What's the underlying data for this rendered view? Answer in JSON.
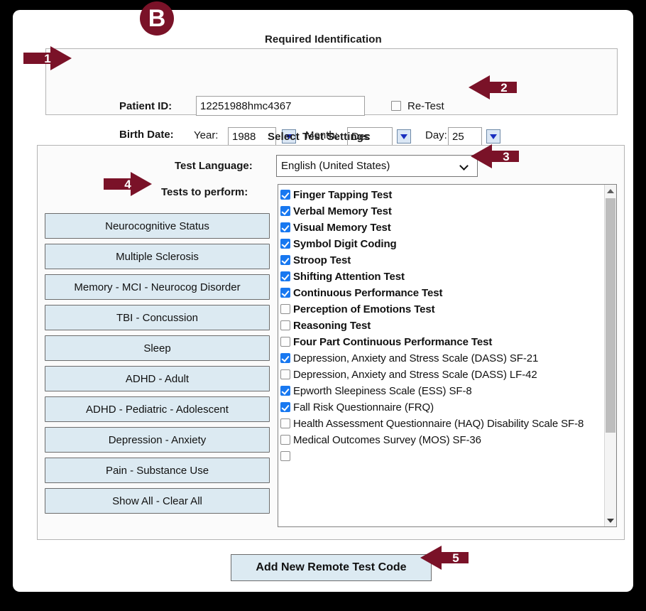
{
  "badge": {
    "letter": "B"
  },
  "identification": {
    "legend": "Required Identification",
    "patient_id_label": "Patient ID:",
    "patient_id_value": "12251988hmc4367",
    "patient_id_placeholder": "",
    "retest_label": "Re-Test",
    "retest_checked": false,
    "birth_date_label": "Birth Date:",
    "year_label": "Year:",
    "year_value": "1988",
    "month_label": "Month:",
    "month_value": "Dec",
    "day_label": "Day:",
    "day_value": "25",
    "spinner_icon": "triangle-down-icon"
  },
  "settings": {
    "legend": "Select Test Settings",
    "language_label": "Test Language:",
    "language_value": "English (United States)",
    "language_chevron_icon": "chevron-down-icon",
    "tests_label": "Tests to perform:"
  },
  "category_buttons": [
    "Neurocognitive Status",
    "Multiple Sclerosis",
    "Memory - MCI - Neurocog Disorder",
    "TBI - Concussion",
    "Sleep",
    "ADHD - Adult",
    "ADHD - Pediatric - Adolescent",
    "Depression - Anxiety",
    "Pain - Substance Use",
    "Show All - Clear All"
  ],
  "test_list": [
    {
      "label": "Finger Tapping Test",
      "checked": true,
      "bold": true
    },
    {
      "label": "Verbal Memory Test",
      "checked": true,
      "bold": true
    },
    {
      "label": "Visual Memory Test",
      "checked": true,
      "bold": true
    },
    {
      "label": "Symbol Digit Coding",
      "checked": true,
      "bold": true
    },
    {
      "label": "Stroop Test",
      "checked": true,
      "bold": true
    },
    {
      "label": "Shifting Attention Test",
      "checked": true,
      "bold": true
    },
    {
      "label": "Continuous Performance Test",
      "checked": true,
      "bold": true
    },
    {
      "label": "Perception of Emotions Test",
      "checked": false,
      "bold": true
    },
    {
      "label": "Reasoning Test",
      "checked": false,
      "bold": true
    },
    {
      "label": "Four Part Continuous Performance Test",
      "checked": false,
      "bold": true
    },
    {
      "label": "Depression, Anxiety and Stress Scale (DASS) SF-21",
      "checked": true,
      "bold": false
    },
    {
      "label": "Depression, Anxiety and Stress Scale (DASS) LF-42",
      "checked": false,
      "bold": false
    },
    {
      "label": "Epworth Sleepiness Scale (ESS) SF-8",
      "checked": true,
      "bold": false
    },
    {
      "label": "Fall Risk Questionnaire (FRQ)",
      "checked": true,
      "bold": false
    },
    {
      "label": "Health Assessment Questionnaire (HAQ) Disability Scale SF-8",
      "checked": false,
      "bold": false
    },
    {
      "label": "Medical Outcomes Survey (MOS) SF-36",
      "checked": false,
      "bold": false
    }
  ],
  "scrollbar": {
    "up_icon": "triangle-up-icon",
    "down_icon": "triangle-down-icon"
  },
  "submit": {
    "label": "Add New Remote Test Code"
  },
  "callouts": [
    {
      "number": "1",
      "direction": "right"
    },
    {
      "number": "2",
      "direction": "left"
    },
    {
      "number": "3",
      "direction": "left"
    },
    {
      "number": "4",
      "direction": "right"
    },
    {
      "number": "5",
      "direction": "left"
    }
  ],
  "colors": {
    "callout": "#7a1228",
    "button_face": "#dceaf2",
    "checkbox_checked": "#1878f0"
  }
}
